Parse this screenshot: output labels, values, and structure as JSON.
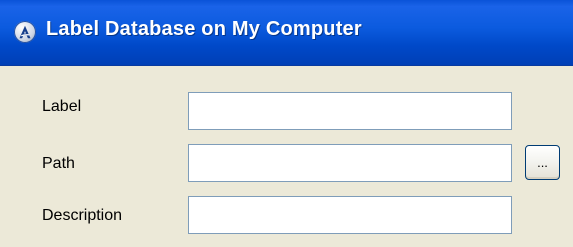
{
  "window": {
    "title": "Label Database on My Computer",
    "icon": "app-logo-icon"
  },
  "form": {
    "fields": [
      {
        "label": "Label",
        "value": "",
        "placeholder": ""
      },
      {
        "label": "Path",
        "value": "",
        "placeholder": "",
        "browse_label": "..."
      },
      {
        "label": "Description",
        "value": "",
        "placeholder": ""
      }
    ]
  },
  "colors": {
    "title_bar": "#0a53d8",
    "title_text": "#ffffff",
    "window_background": "#ece9d8",
    "input_border": "#7f9db9"
  }
}
